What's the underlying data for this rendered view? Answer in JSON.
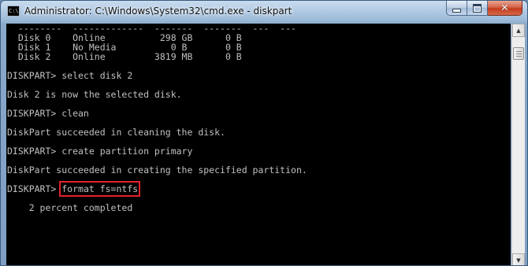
{
  "window": {
    "title": "Administrator: C:\\Windows\\System32\\cmd.exe - diskpart",
    "icon_label": "C:\\",
    "controls": {
      "minimize_icon": "minimize-icon",
      "maximize_icon": "maximize-icon",
      "close_icon": "close-icon",
      "close_glyph": "✕"
    }
  },
  "console": {
    "colors": {
      "background": "#000000",
      "text": "#c0c0c0",
      "highlight_box": "#e0232b"
    },
    "lines": [
      "  --------  -------------  -------  -------  ---  ---",
      "  Disk 0    Online          298 GB      0 B",
      "  Disk 1    No Media          0 B       0 B",
      "  Disk 2    Online         3819 MB      0 B",
      "",
      "DISKPART> select disk 2",
      "",
      "Disk 2 is now the selected disk.",
      "",
      "DISKPART> clean",
      "",
      "DiskPart succeeded in cleaning the disk.",
      "",
      "DISKPART> create partition primary",
      "",
      "DiskPart succeeded in creating the specified partition.",
      "",
      "",
      "",
      "    2 percent completed"
    ],
    "current_prompt": "DISKPART> ",
    "highlighted_command": "format fs=ntfs"
  },
  "scrollbar": {
    "up_glyph": "▲",
    "down_glyph": "▼"
  }
}
